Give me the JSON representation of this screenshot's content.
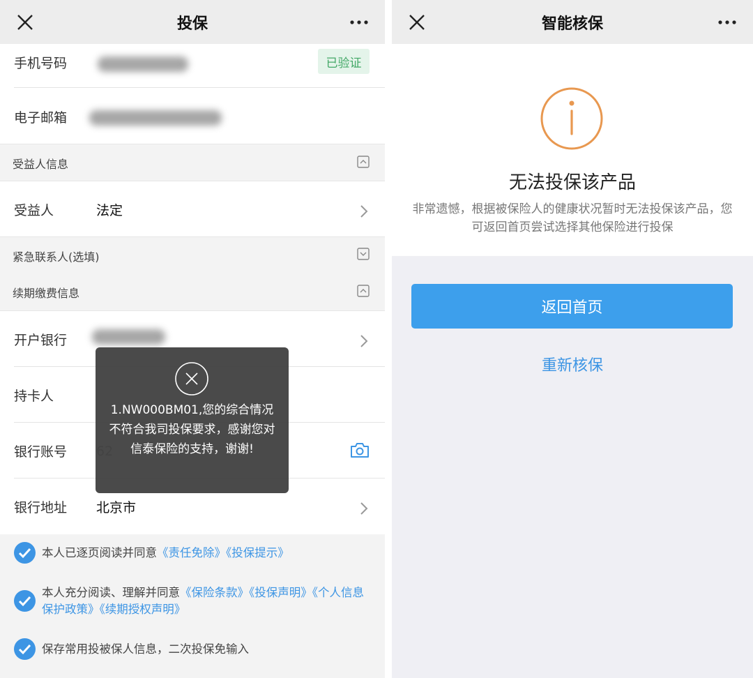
{
  "left": {
    "title": "投保",
    "phone": {
      "label": "手机号码",
      "badge": "已验证"
    },
    "email": {
      "label": "电子邮箱"
    },
    "beneficiary_section": "受益人信息",
    "beneficiary": {
      "label": "受益人",
      "value": "法定"
    },
    "emergency_section": "紧急联系人(选填)",
    "renewal_section": "续期缴费信息",
    "bank": {
      "label": "开户银行"
    },
    "cardholder": {
      "label": "持卡人"
    },
    "account": {
      "label": "银行账号",
      "value_partial": "62"
    },
    "bank_address": {
      "label": "银行地址",
      "value": "北京市"
    },
    "agreements": [
      {
        "prefix": "本人已逐页阅读并同意",
        "links": [
          "《责任免除》",
          "《投保提示》"
        ]
      },
      {
        "prefix": "本人充分阅读、理解并同意",
        "links": [
          "《保险条款》",
          "《投保声明》",
          "《个人信息保护政策》",
          "《续期授权声明》"
        ]
      },
      {
        "prefix": "保存常用投被保人信息，二次投保免输入",
        "links": []
      }
    ],
    "toast": "1.NW000BM01,您的综合情况不符合我司投保要求，感谢您对信泰保险的支持，谢谢!"
  },
  "right": {
    "title": "智能核保",
    "result_title": "无法投保该产品",
    "result_desc": "非常遗憾，根据被保险人的健康状况暂时无法投保该产品，您可返回首页尝试选择其他保险进行投保",
    "home_button": "返回首页",
    "retry_button": "重新核保"
  },
  "colors": {
    "accent": "#3d95e4",
    "button": "#3d9fec",
    "warning": "#e89850",
    "verified": "#43a867"
  },
  "icons": [
    "close-icon",
    "more-icon",
    "collapse-icon",
    "expand-icon",
    "chevron-right-icon",
    "camera-icon",
    "check-icon",
    "warning-icon"
  ]
}
